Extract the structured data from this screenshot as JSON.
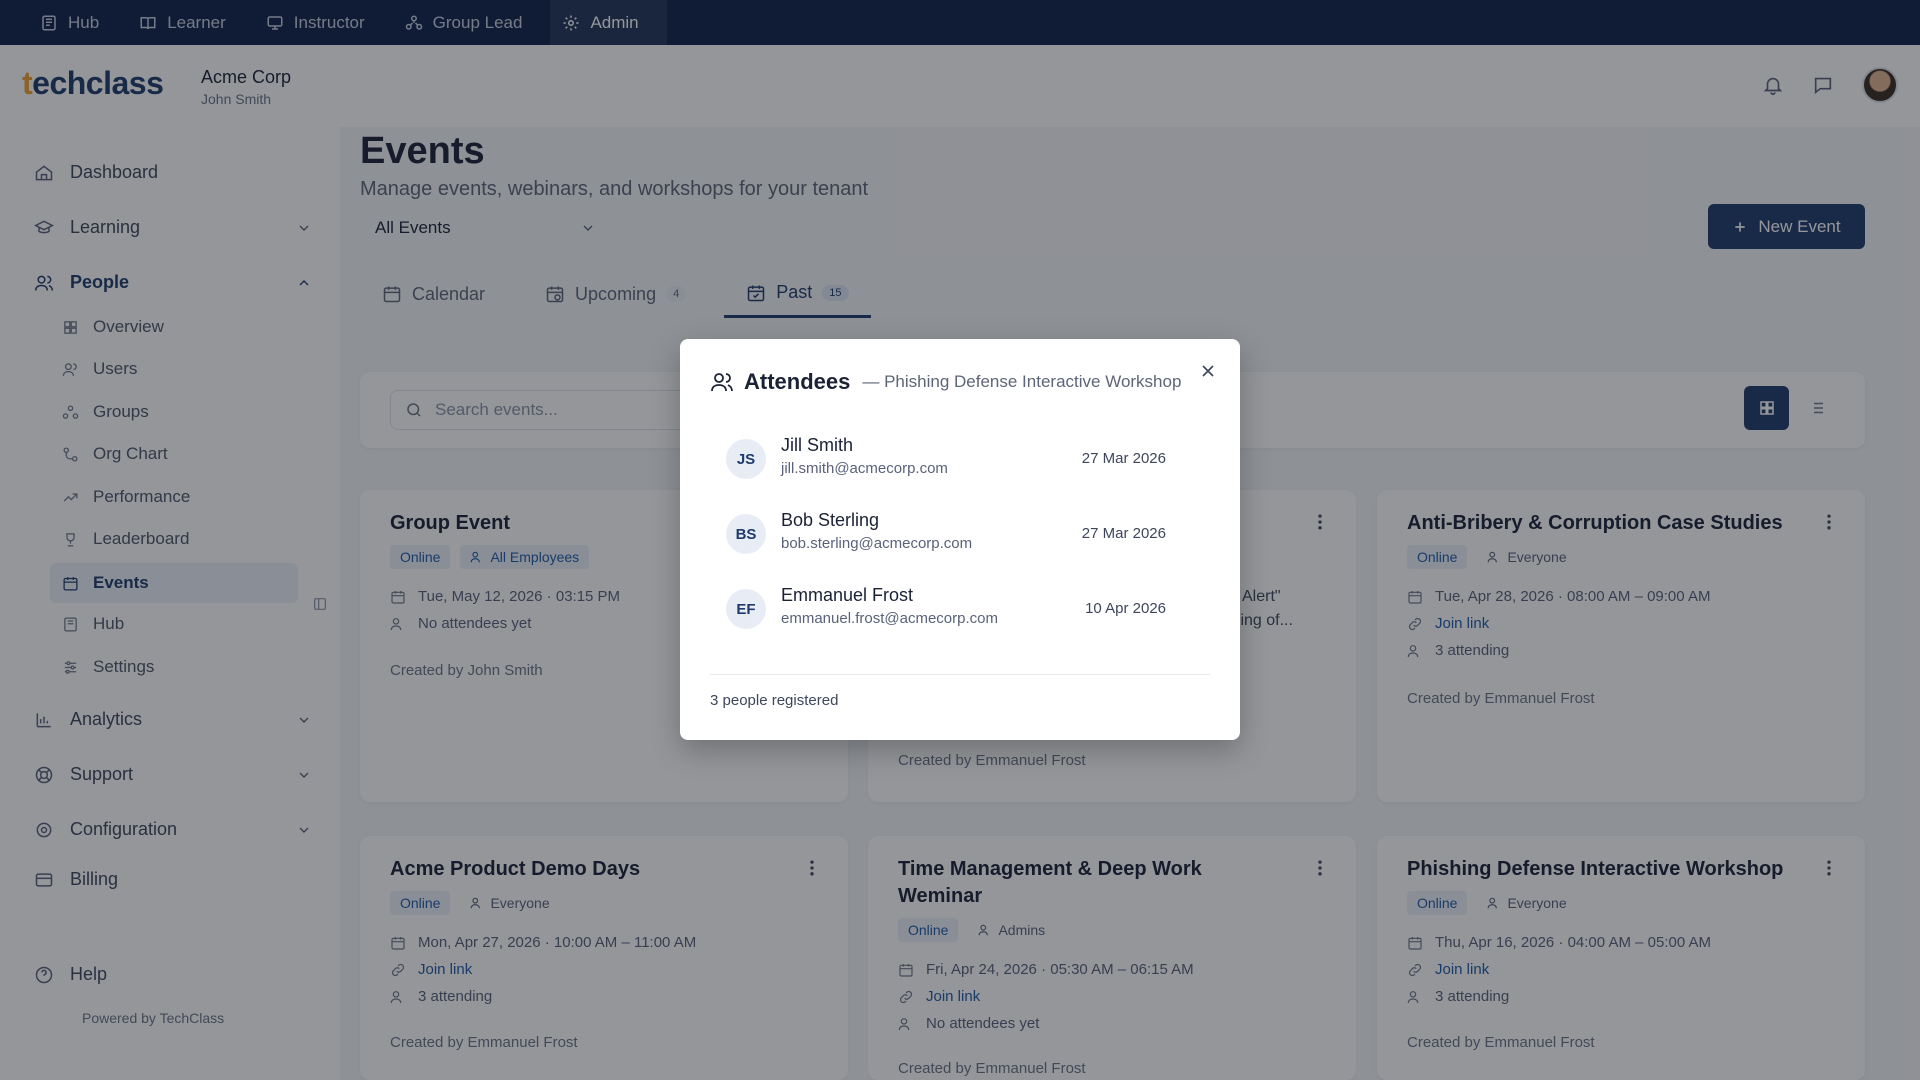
{
  "topnav": {
    "tabs": [
      {
        "label": "Hub",
        "icon": "hub-icon"
      },
      {
        "label": "Learner",
        "icon": "book-icon"
      },
      {
        "label": "Instructor",
        "icon": "monitor-icon"
      },
      {
        "label": "Group Lead",
        "icon": "group-icon"
      },
      {
        "label": "Admin",
        "icon": "gear-icon",
        "active": true
      }
    ]
  },
  "header": {
    "logo": "techclass",
    "tenant_name": "Acme Corp",
    "user_name": "John Smith"
  },
  "sidebar": {
    "items": [
      {
        "label": "Dashboard"
      },
      {
        "label": "Learning"
      },
      {
        "label": "People"
      },
      {
        "label": "Analytics"
      },
      {
        "label": "Support"
      },
      {
        "label": "Configuration"
      },
      {
        "label": "Billing"
      },
      {
        "label": "Help"
      }
    ],
    "people_sub": [
      {
        "label": "Overview"
      },
      {
        "label": "Users"
      },
      {
        "label": "Groups"
      },
      {
        "label": "Org Chart"
      },
      {
        "label": "Performance"
      },
      {
        "label": "Leaderboard"
      },
      {
        "label": "Events"
      },
      {
        "label": "Hub"
      },
      {
        "label": "Settings"
      }
    ],
    "powered_by": "Powered by TechClass"
  },
  "main": {
    "title": "Events",
    "subtitle": "Manage events, webinars, and workshops for your tenant",
    "filter_value": "All Events",
    "new_button": "New Event",
    "tabs": [
      {
        "label": "Calendar",
        "badge": ""
      },
      {
        "label": "Upcoming",
        "badge": "4"
      },
      {
        "label": "Past",
        "badge": "15"
      }
    ],
    "search_placeholder": "Search events..."
  },
  "cards": [
    {
      "title": "Group Event",
      "type": "Online",
      "audience": "All Employees",
      "date": "Tue, May 12, 2026 · 03:15 PM",
      "link": "",
      "attendance": "No attendees yet",
      "created": "Created by John Smith"
    },
    {
      "title": "",
      "description_fragment_1": "t Alert\"",
      "description_fragment_2": "dling of...",
      "created": "Created by Emmanuel Frost"
    },
    {
      "title": "Anti-Bribery & Corruption Case Studies",
      "type": "Online",
      "audience": "Everyone",
      "date": "Tue, Apr 28, 2026 · 08:00 AM – 09:00 AM",
      "link": "Join link",
      "attendance": "3 attending",
      "created": "Created by Emmanuel Frost"
    },
    {
      "title": "Acme Product Demo Days",
      "type": "Online",
      "audience": "Everyone",
      "date": "Mon, Apr 27, 2026 · 10:00 AM – 11:00 AM",
      "link": "Join link",
      "attendance": "3 attending",
      "created": "Created by Emmanuel Frost"
    },
    {
      "title": "Time Management & Deep Work Weminar",
      "type": "Online",
      "audience": "Admins",
      "date": "Fri, Apr 24, 2026 · 05:30 AM – 06:15 AM",
      "link": "Join link",
      "attendance": "No attendees yet",
      "created": "Created by Emmanuel Frost"
    },
    {
      "title": "Phishing Defense Interactive Workshop",
      "type": "Online",
      "audience": "Everyone",
      "date": "Thu, Apr 16, 2026 · 04:00 AM – 05:00 AM",
      "link": "Join link",
      "attendance": "3 attending",
      "created": "Created by Emmanuel Frost"
    }
  ],
  "modal": {
    "title": "Attendees",
    "subtitle": "— Phishing Defense Interactive Workshop",
    "attendees": [
      {
        "initials": "JS",
        "name": "Jill Smith",
        "email": "jill.smith@acmecorp.com",
        "date": "27 Mar 2026"
      },
      {
        "initials": "BS",
        "name": "Bob Sterling",
        "email": "bob.sterling@acmecorp.com",
        "date": "27 Mar 2026"
      },
      {
        "initials": "EF",
        "name": "Emmanuel Frost",
        "email": "emmanuel.frost@acmecorp.com",
        "date": "10 Apr 2026"
      }
    ],
    "footer": "3 people registered"
  },
  "colors": {
    "brand": "#1f3b6b",
    "topnav": "#0f2247",
    "accent_logo": "#f2a02a",
    "link": "#1f5aa6"
  }
}
